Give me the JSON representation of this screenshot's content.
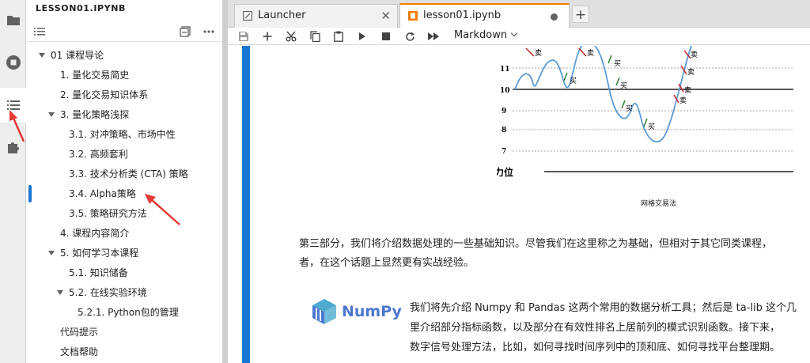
{
  "sidebar": {
    "title": "LESSON01.IPYNB",
    "items": [
      {
        "label": "01 课程导论",
        "caret": true
      },
      {
        "label": "1. 量化交易简史"
      },
      {
        "label": "2. 量化交易知识体系"
      },
      {
        "label": "3. 量化策略浅探",
        "caret": true
      },
      {
        "label": "3.1. 对冲策略、市场中性"
      },
      {
        "label": "3.2. 高频套利"
      },
      {
        "label": "3.3. 技术分析类 (CTA) 策略"
      },
      {
        "label": "3.4. Alpha策略"
      },
      {
        "label": "3.5. 策略研究方法"
      },
      {
        "label": "4. 课程内容简介"
      },
      {
        "label": "5. 如何学习本课程",
        "caret": true
      },
      {
        "label": "5.1. 知识储备"
      },
      {
        "label": "5.2. 在线实验环境",
        "caret": true
      },
      {
        "label": "5.2.1. Python包的管理"
      },
      {
        "label": "代码提示"
      },
      {
        "label": "文档帮助"
      }
    ]
  },
  "tabs": [
    {
      "label": "Launcher",
      "icon": "launcher-icon"
    },
    {
      "label": "lesson01.ipynb",
      "icon": "notebook-icon",
      "active": true
    }
  ],
  "toolbar": {
    "cell_type": "Markdown"
  },
  "figure": {
    "y_ticks": [
      "11",
      "10",
      "9",
      "8",
      "7"
    ],
    "resistance_label": "阻力位",
    "buy_label": "买",
    "sell_label": "卖",
    "caption": "网格交易法"
  },
  "content": {
    "para1_line1": "第三部分，我们将介绍数据处理的一些基础知识。尽管我们在这里称之为基础，但相对于其它同类课程，",
    "para1_line2": "者，在这个话题上显然更有实战经验。",
    "numpy_logo": "NumPy",
    "para2_line1": "我们将先介绍 Numpy 和 Pandas 这两个常用的数据分析工具；然后是 ta-lib 这个几",
    "para2_line2": "里介绍部分指标函数，以及部分在有效性排名上居前列的模式识别函数。接下来，",
    "para2_line3": "数字信号处理方法，比如，如何寻找时间序列中的顶和底、如何寻找平台整理期。"
  },
  "colors": {
    "accent": "#1976d2",
    "active_tab": "#f57c00",
    "annotation_arrow": "#e53935",
    "curve": "#5b9bd5",
    "buy_arrow": "#2e7d32",
    "sell_arrow": "#c62828"
  }
}
